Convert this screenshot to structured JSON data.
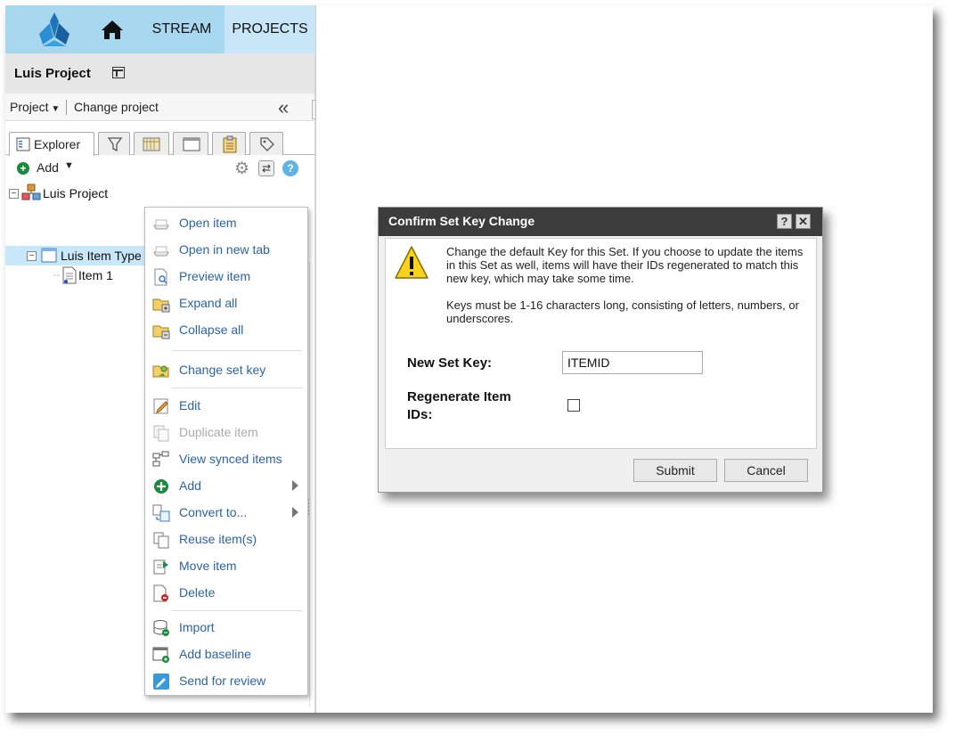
{
  "nav": {
    "stream": "STREAM",
    "projects": "PROJECTS"
  },
  "project": {
    "title": "Luis Project",
    "menu_label": "Project",
    "change_label": "Change project"
  },
  "tabs": {
    "explorer": "Explorer"
  },
  "toolbar": {
    "add_label": "Add"
  },
  "tree": {
    "root": "Luis Project",
    "set": "Luis Item Type SET",
    "item": "Item 1"
  },
  "context_menu": {
    "items": [
      {
        "label": "Open item"
      },
      {
        "label": "Open in new tab"
      },
      {
        "label": "Preview item"
      },
      {
        "label": "Expand all"
      },
      {
        "label": "Collapse all"
      },
      {
        "label": "Change set key"
      },
      {
        "label": "Edit"
      },
      {
        "label": "Duplicate item",
        "disabled": true
      },
      {
        "label": "View synced items"
      },
      {
        "label": "Add"
      },
      {
        "label": "Convert to..."
      },
      {
        "label": "Reuse item(s)"
      },
      {
        "label": "Move item"
      },
      {
        "label": "Delete"
      },
      {
        "label": "Import"
      },
      {
        "label": "Add baseline"
      },
      {
        "label": "Send for review"
      }
    ]
  },
  "dialog": {
    "title": "Confirm Set Key Change",
    "help_btn": "?",
    "close_btn": "✕",
    "message1": "Change the default Key for this Set. If you choose to update the items in this Set as well, items will have their IDs regenerated to match this new key, which may take some time.",
    "message2": "Keys must be 1-16 characters long, consisting of letters, numbers, or underscores.",
    "new_key_label": "New Set Key:",
    "new_key_value": "ITEMID",
    "regen_label_1": "Regenerate Item",
    "regen_label_2": "IDs:",
    "regen_checked": false,
    "submit_label": "Submit",
    "cancel_label": "Cancel"
  },
  "colors": {
    "nav_bg": "#a8d7f0",
    "nav_active": "#c7e6f7",
    "menu_text": "#2b63a8",
    "dialog_header": "#3c3c3c",
    "selection": "#c8e7f8"
  }
}
